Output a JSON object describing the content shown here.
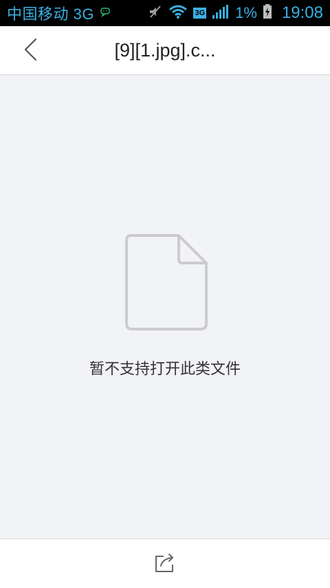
{
  "status_bar": {
    "carrier": "中国移动 3G",
    "network_badge": "3G",
    "battery_percent": "1%",
    "time": "19:08",
    "icons": [
      "chat-icon",
      "mute-icon",
      "wifi-icon",
      "signal-icon",
      "battery-charging-icon"
    ]
  },
  "header": {
    "title": "[9][1.jpg].c..."
  },
  "main": {
    "message": "暂不支持打开此类文件"
  },
  "colors": {
    "status_text": "#3ab0e2",
    "background": "#f2f3f7",
    "icon_gray": "#cccccc"
  }
}
